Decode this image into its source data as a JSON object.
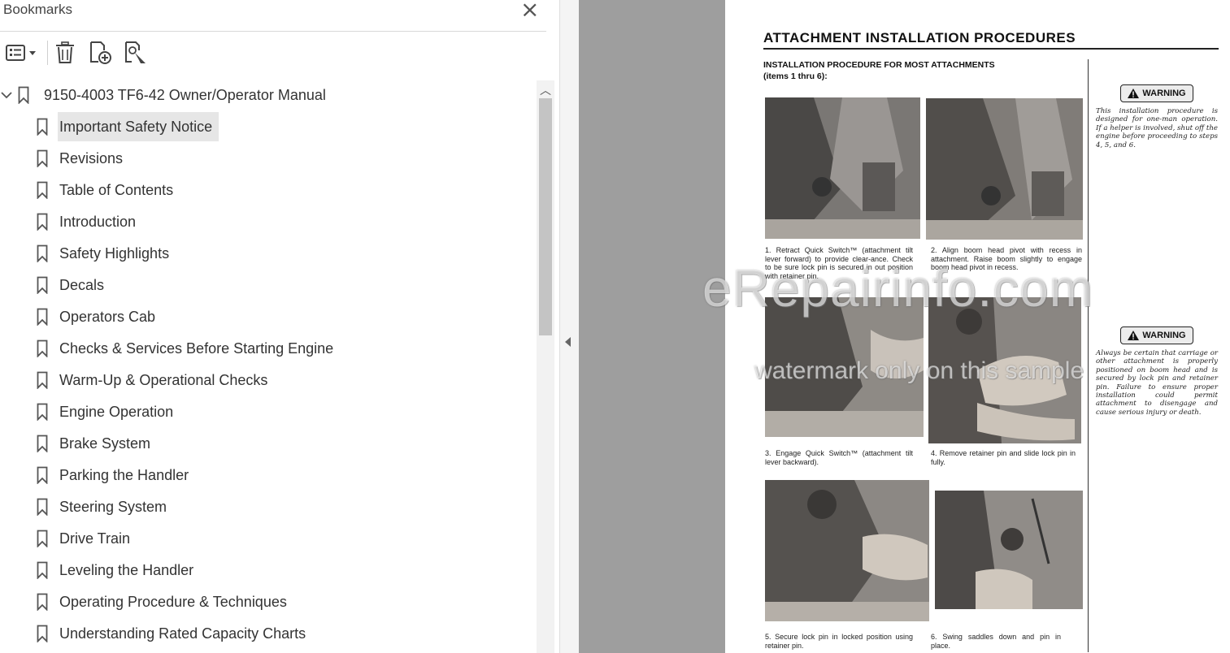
{
  "panel": {
    "title": "Bookmarks",
    "close_glyph": "×"
  },
  "toolbar": {
    "icons": [
      "bookmark-options-icon",
      "delete-bookmark-icon",
      "new-bookmark-icon",
      "find-bookmark-icon"
    ]
  },
  "tree": {
    "root": {
      "label": "9150-4003 TF6-42 Owner/Operator Manual",
      "expanded": true
    },
    "items": [
      {
        "label": "Important Safety Notice",
        "selected": true
      },
      {
        "label": "Revisions"
      },
      {
        "label": "Table of Contents"
      },
      {
        "label": "Introduction"
      },
      {
        "label": "Safety Highlights"
      },
      {
        "label": "Decals"
      },
      {
        "label": "Operators Cab"
      },
      {
        "label": "Checks & Services Before Starting Engine"
      },
      {
        "label": "Warm-Up & Operational Checks"
      },
      {
        "label": "Engine Operation"
      },
      {
        "label": "Brake System"
      },
      {
        "label": "Parking the Handler"
      },
      {
        "label": "Steering System"
      },
      {
        "label": "Drive Train"
      },
      {
        "label": "Leveling the Handler"
      },
      {
        "label": "Operating Procedure & Techniques"
      },
      {
        "label": "Understanding Rated Capacity Charts"
      }
    ]
  },
  "document": {
    "title": "ATTACHMENT INSTALLATION PROCEDURES",
    "subhead_line1": "INSTALLATION PROCEDURE FOR MOST ATTACHMENTS",
    "subhead_line2": "(items 1 thru 6):",
    "steps": [
      {
        "num": "1.",
        "text": "Retract Quick Switch™ (attachment tilt lever forward) to provide clear-ance. Check to be sure lock pin is secured in out position with retainer pin."
      },
      {
        "num": "2.",
        "text": "Align boom head pivot with recess in attachment. Raise boom slightly to engage boom head pivot in recess."
      },
      {
        "num": "3.",
        "text": "Engage Quick Switch™ (attachment tilt lever backward)."
      },
      {
        "num": "4.",
        "text": "Remove retainer pin and slide lock pin in fully."
      },
      {
        "num": "5.",
        "text": "Secure lock pin in locked position using retainer pin."
      },
      {
        "num": "6.",
        "text": "Swing saddles down and pin in place."
      }
    ],
    "warnings": [
      {
        "label": "WARNING",
        "text": "This installation procedure is designed for one-man operation. If a helper is involved, shut off the engine before proceeding to steps 4, 5, and 6."
      },
      {
        "label": "WARNING",
        "text": "Always be certain that carriage or other attachment is properly positioned on boom head and is secured by lock pin and retainer pin. Failure to ensure proper installation could permit attachment to disengage and cause serious injury or death."
      }
    ]
  },
  "watermark": {
    "line1": "eRepairinfo.com",
    "line2": "watermark only on this sample"
  }
}
